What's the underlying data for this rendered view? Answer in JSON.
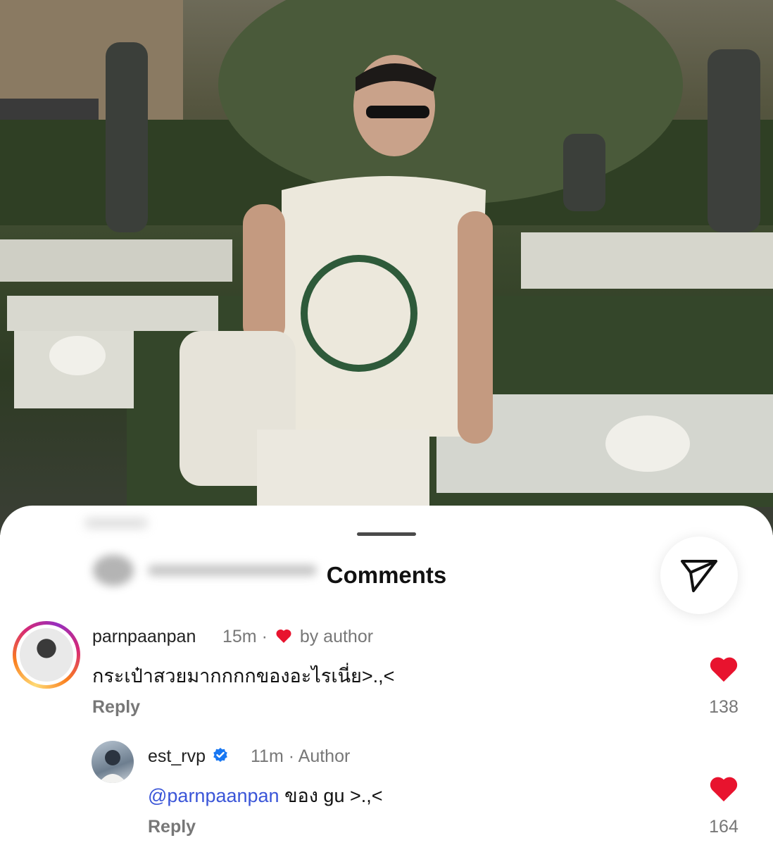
{
  "sheet": {
    "title": "Comments",
    "send_icon": "send-icon"
  },
  "comments": [
    {
      "username": "parnpaanpan",
      "time": "15m",
      "separator": "·",
      "liked_label": "by author",
      "text": "กระเป๋าสวยมากกกกของอะไรเนี่ย>.,<",
      "reply_label": "Reply",
      "likes": "138"
    },
    {
      "username": "est_rvp",
      "verified": true,
      "time": "11m",
      "separator": "·",
      "role": "Author",
      "mention": "@parnpaanpan",
      "text": " ของ gu >.,<",
      "reply_label": "Reply",
      "likes": "164"
    }
  ],
  "colors": {
    "heart": "#e8132e",
    "verified": "#1877f2",
    "mention": "#3a55d8"
  }
}
